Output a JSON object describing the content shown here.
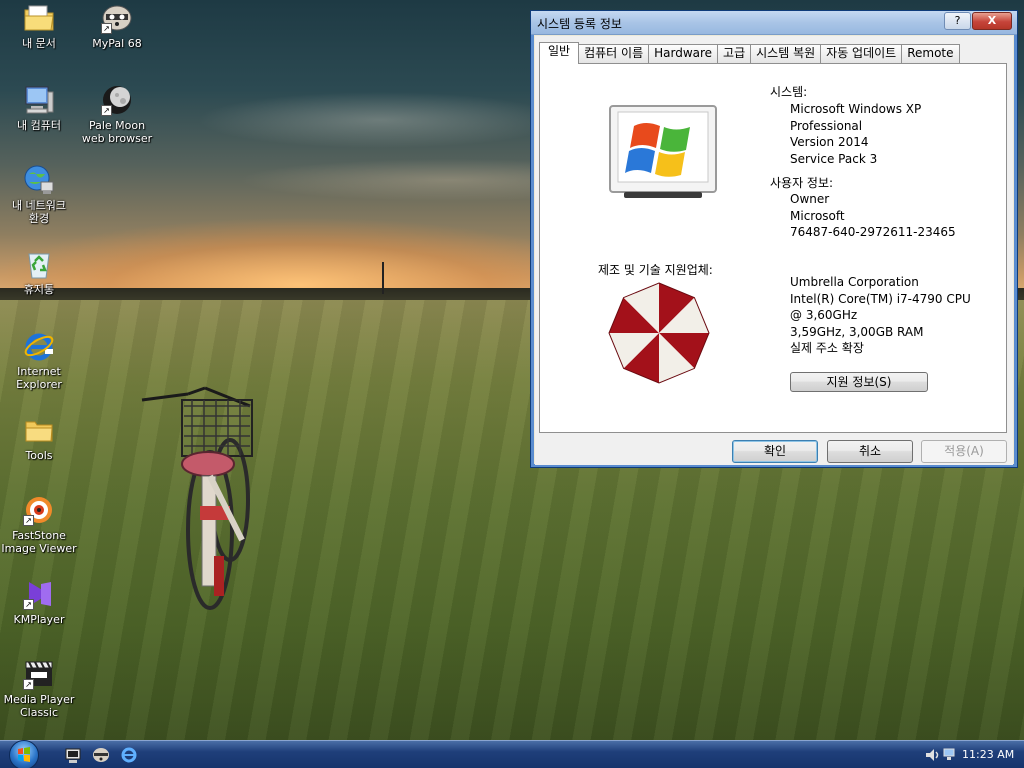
{
  "desktop": {
    "icons": [
      {
        "label": "내 문서",
        "icon": "my-documents-folder-icon"
      },
      {
        "label": "MyPal 68",
        "icon": "mypal-raccoon-icon"
      },
      {
        "label": "내 컴퓨터",
        "icon": "my-computer-icon"
      },
      {
        "label": "Pale Moon\nweb browser",
        "icon": "pale-moon-icon"
      },
      {
        "label": "내 네트워크\n환경",
        "icon": "network-places-icon"
      },
      {
        "label": "휴지통",
        "icon": "recycle-bin-icon"
      },
      {
        "label": "Internet\nExplorer",
        "icon": "internet-explorer-icon"
      },
      {
        "label": "Tools",
        "icon": "folder-icon"
      },
      {
        "label": "FastStone\nImage Viewer",
        "icon": "faststone-icon"
      },
      {
        "label": "KMPlayer",
        "icon": "kmplayer-icon"
      },
      {
        "label": "Media Player\nClassic",
        "icon": "mpc-clapper-icon"
      }
    ]
  },
  "dialog": {
    "title": "시스템 등록 정보",
    "help_label": "?",
    "close_label": "X",
    "tabs": [
      "일반",
      "컴퓨터 이름",
      "Hardware",
      "고급",
      "시스템 복원",
      "자동 업데이트",
      "Remote"
    ],
    "system": {
      "heading": "시스템:",
      "lines": [
        "Microsoft Windows XP",
        "Professional",
        "Version 2014",
        "Service Pack 3"
      ]
    },
    "user": {
      "heading": "사용자 정보:",
      "lines": [
        "Owner",
        "Microsoft",
        "76487-640-2972611-23465"
      ]
    },
    "manufacturer": {
      "heading": "제조 및 기술 지원업체:",
      "lines": [
        "Umbrella Corporation",
        "Intel(R) Core(TM) i7-4790 CPU",
        "@ 3,60GHz",
        "3,59GHz, 3,00GB RAM",
        "실제 주소 확장"
      ]
    },
    "support_button": "지원 정보(S)",
    "buttons": {
      "ok": "확인",
      "cancel": "취소",
      "apply": "적용(A)"
    }
  },
  "taskbar": {
    "clock": "11:23 AM",
    "quick_launch": [
      "show-desktop-icon",
      "mypal-raccoon-icon",
      "internet-explorer-icon"
    ],
    "tray": [
      "volume-speaker-icon"
    ]
  },
  "colors": {
    "dialog_bg": "#ece9d8",
    "titlebar": "#a9c4e6",
    "taskbar": "#1f3f7a",
    "umbrella_red": "#a3111a"
  }
}
